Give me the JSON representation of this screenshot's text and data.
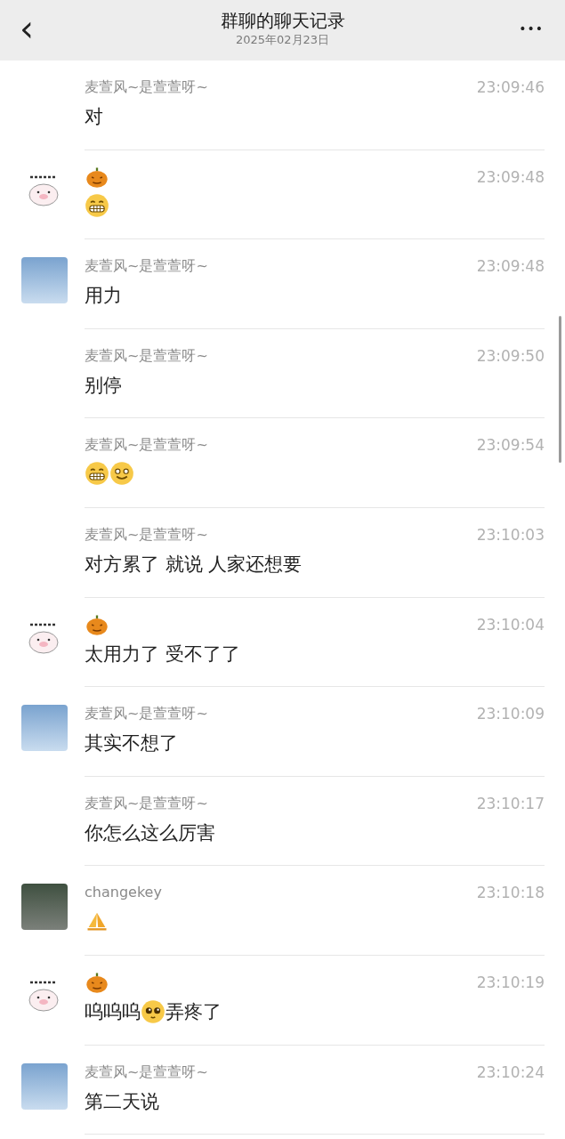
{
  "header": {
    "back": "‹",
    "title": "群聊的聊天记录",
    "date": "2025年02月23日",
    "more": "•••"
  },
  "messages": [
    {
      "sender": [
        {
          "kind": "text",
          "text": "麦萱风~是萱萱呀~"
        }
      ],
      "time": "23:09:46",
      "content": [
        {
          "kind": "text",
          "text": "对"
        }
      ]
    },
    {
      "avatar": {
        "kind": "sticker"
      },
      "sender": [
        {
          "kind": "pumpkin"
        }
      ],
      "time": "23:09:48",
      "content": [
        {
          "kind": "grin"
        }
      ]
    },
    {
      "avatar": {
        "kind": "photo"
      },
      "sender": [
        {
          "kind": "text",
          "text": "麦萱风~是萱萱呀~"
        }
      ],
      "time": "23:09:48",
      "content": [
        {
          "kind": "text",
          "text": "用力"
        }
      ]
    },
    {
      "sender": [
        {
          "kind": "text",
          "text": "麦萱风~是萱萱呀~"
        }
      ],
      "time": "23:09:50",
      "content": [
        {
          "kind": "text",
          "text": "别停"
        }
      ]
    },
    {
      "sender": [
        {
          "kind": "text",
          "text": "麦萱风~是萱萱呀~"
        }
      ],
      "time": "23:09:54",
      "content": [
        {
          "kind": "grin"
        },
        {
          "kind": "wink"
        }
      ]
    },
    {
      "sender": [
        {
          "kind": "text",
          "text": "麦萱风~是萱萱呀~"
        }
      ],
      "time": "23:10:03",
      "content": [
        {
          "kind": "text",
          "text": "对方累了 就说 人家还想要"
        }
      ]
    },
    {
      "avatar": {
        "kind": "sticker"
      },
      "sender": [
        {
          "kind": "pumpkin"
        }
      ],
      "time": "23:10:04",
      "content": [
        {
          "kind": "text",
          "text": "太用力了 受不了了"
        }
      ]
    },
    {
      "avatar": {
        "kind": "photo"
      },
      "sender": [
        {
          "kind": "text",
          "text": "麦萱风~是萱萱呀~"
        }
      ],
      "time": "23:10:09",
      "content": [
        {
          "kind": "text",
          "text": "其实不想了"
        }
      ]
    },
    {
      "sender": [
        {
          "kind": "text",
          "text": "麦萱风~是萱萱呀~"
        }
      ],
      "time": "23:10:17",
      "content": [
        {
          "kind": "text",
          "text": "你怎么这么厉害"
        }
      ]
    },
    {
      "avatar": {
        "kind": "street"
      },
      "sender": [
        {
          "kind": "text",
          "text": "changekey"
        }
      ],
      "time": "23:10:18",
      "content": [
        {
          "kind": "palms"
        }
      ]
    },
    {
      "avatar": {
        "kind": "sticker"
      },
      "sender": [
        {
          "kind": "pumpkin"
        }
      ],
      "time": "23:10:19",
      "content": [
        {
          "kind": "text",
          "text": "呜呜呜"
        },
        {
          "kind": "pleading"
        },
        {
          "kind": "text",
          "text": "弄疼了"
        }
      ]
    },
    {
      "avatar": {
        "kind": "photo"
      },
      "sender": [
        {
          "kind": "text",
          "text": "麦萱风~是萱萱呀~"
        }
      ],
      "time": "23:10:24",
      "content": [
        {
          "kind": "text",
          "text": "第二天说"
        }
      ]
    }
  ]
}
